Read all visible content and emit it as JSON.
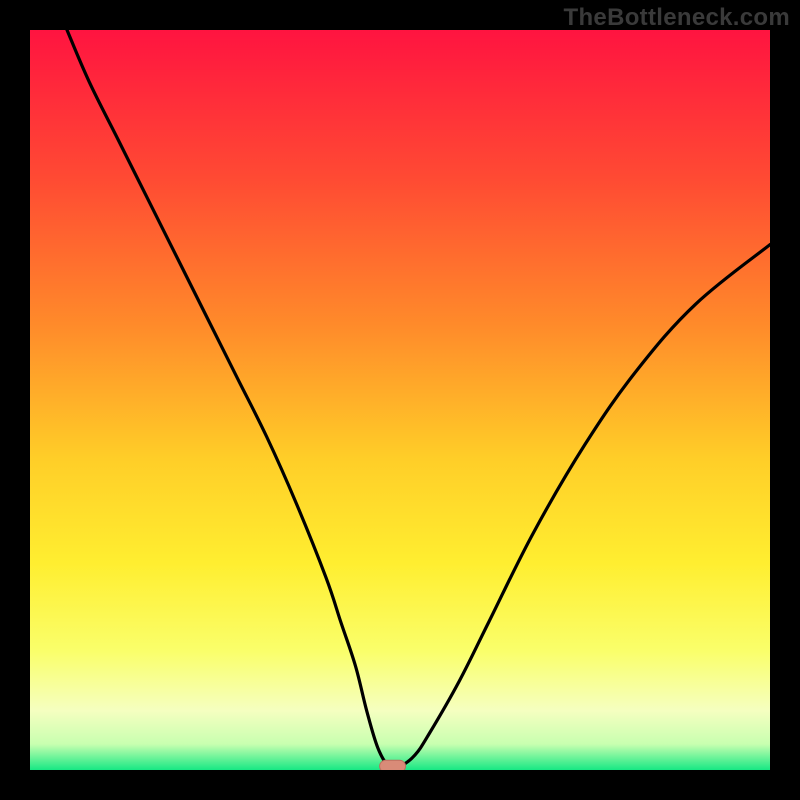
{
  "watermark": "TheBottleneck.com",
  "colors": {
    "frame": "#000000",
    "gradient_stops": [
      {
        "offset": 0.0,
        "color": "#ff1440"
      },
      {
        "offset": 0.2,
        "color": "#ff4a33"
      },
      {
        "offset": 0.4,
        "color": "#ff8b2a"
      },
      {
        "offset": 0.58,
        "color": "#ffce28"
      },
      {
        "offset": 0.72,
        "color": "#ffee30"
      },
      {
        "offset": 0.84,
        "color": "#faff6b"
      },
      {
        "offset": 0.92,
        "color": "#f5ffc0"
      },
      {
        "offset": 0.965,
        "color": "#c8ffb0"
      },
      {
        "offset": 1.0,
        "color": "#17e884"
      }
    ],
    "curve": "#000000",
    "marker_fill": "#d98b78",
    "marker_stroke": "#bd6f5f"
  },
  "chart_data": {
    "type": "line",
    "title": "",
    "xlabel": "",
    "ylabel": "",
    "xlim": [
      0,
      100
    ],
    "ylim": [
      0,
      100
    ],
    "x": [
      5,
      8,
      12,
      16,
      20,
      24,
      28,
      32,
      36,
      40,
      42,
      44,
      45.5,
      47,
      48.5,
      50,
      52,
      54,
      58,
      62,
      68,
      75,
      82,
      90,
      100
    ],
    "values": [
      100,
      93,
      85,
      77,
      69,
      61,
      53,
      45,
      36,
      26,
      20,
      14,
      8,
      3,
      0.5,
      0.5,
      2,
      5,
      12,
      20,
      32,
      44,
      54,
      63,
      71
    ],
    "marker": {
      "x": 49,
      "y": 0.5
    },
    "single_series": true
  }
}
